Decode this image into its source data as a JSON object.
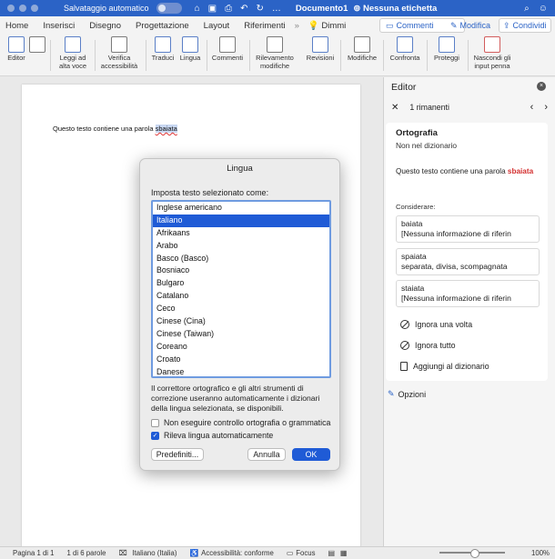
{
  "titlebar": {
    "autosave_label": "Salvataggio automatico",
    "doc_title": "Documento1",
    "label": "Nessuna etichetta"
  },
  "tabs": {
    "items": [
      "Home",
      "Inserisci",
      "Disegno",
      "Progettazione",
      "Layout",
      "Riferimenti",
      "Dimmi"
    ],
    "comments": "Commenti",
    "modifica": "Modifica",
    "share": "Condividi"
  },
  "ribbon": {
    "editor": "Editor",
    "read_aloud": "Leggi ad alta voce",
    "accessibility": "Verifica accessibilità",
    "translate": "Traduci",
    "language": "Lingua",
    "comments": "Commenti",
    "track": "Rilevamento modifiche",
    "reviews": "Revisioni",
    "changes": "Modifiche",
    "compare": "Confronta",
    "protect": "Proteggi",
    "hide_ink": "Nascondi gli input penna"
  },
  "document": {
    "text_before": "Questo testo contiene una parola ",
    "error_word": "sbaiata"
  },
  "dialog": {
    "title": "Lingua",
    "prompt": "Imposta testo selezionato come:",
    "languages": [
      "Inglese americano",
      "Italiano",
      "Afrikaans",
      "Arabo",
      "Basco (Basco)",
      "Bosniaco",
      "Bulgaro",
      "Catalano",
      "Ceco",
      "Cinese (Cina)",
      "Cinese (Taiwan)",
      "Coreano",
      "Croato",
      "Danese"
    ],
    "selected_index": 1,
    "note": "Il correttore ortografico e gli altri strumenti di correzione useranno automaticamente i dizionari della lingua selezionata, se disponibili.",
    "no_check_label": "Non eseguire controllo ortografia o grammatica",
    "detect_label": "Rileva lingua automaticamente",
    "default_btn": "Predefiniti...",
    "cancel_btn": "Annulla",
    "ok_btn": "OK"
  },
  "editor": {
    "title": "Editor",
    "remaining": "1 rimanenti",
    "section": "Ortografia",
    "sub": "Non nel dizionario",
    "sentence_before": "Questo testo contiene una parola ",
    "sentence_word": "sbaiata",
    "consider": "Considerare:",
    "suggestions": [
      {
        "word": "baiata",
        "detail": "[Nessuna informazione di riferin"
      },
      {
        "word": "spaiata",
        "detail": "separata, divisa, scompagnata"
      },
      {
        "word": "staiata",
        "detail": "[Nessuna informazione di riferin"
      }
    ],
    "ignore_once": "Ignora una volta",
    "ignore_all": "Ignora tutto",
    "add_dict": "Aggiungi al dizionario",
    "options": "Opzioni"
  },
  "statusbar": {
    "page": "Pagina 1 di 1",
    "words": "1 di 6 parole",
    "language": "Italiano (Italia)",
    "accessibility": "Accessibilità: conforme",
    "focus": "Focus",
    "zoom": "100%"
  }
}
